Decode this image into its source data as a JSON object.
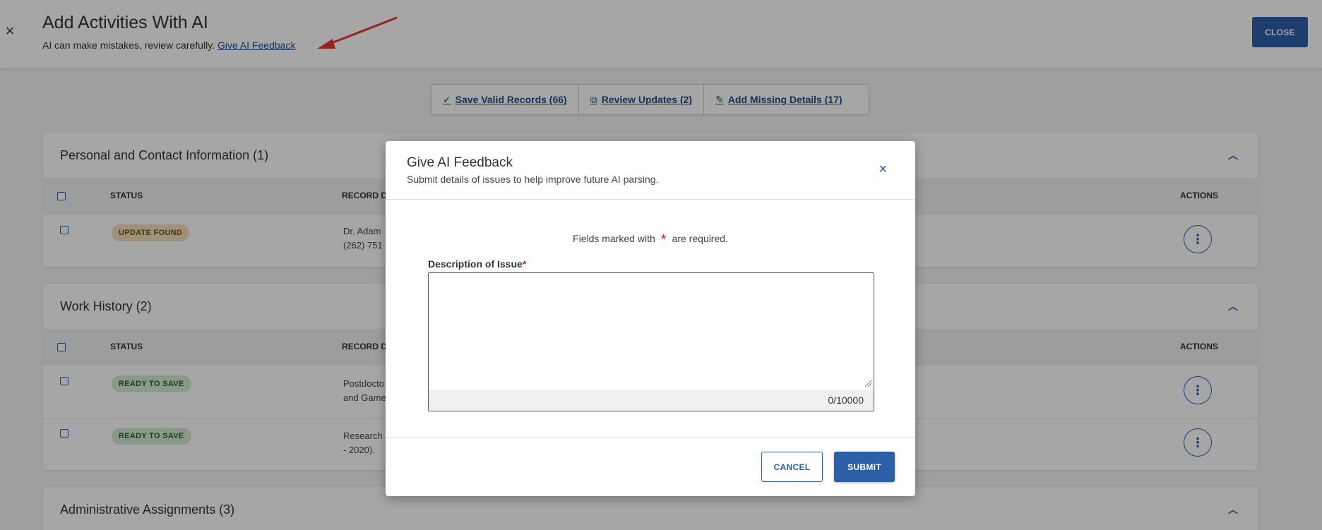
{
  "header": {
    "title": "Add Activities With AI",
    "subtitle": "AI can make mistakes, review carefully.",
    "feedback_link": "Give AI Feedback",
    "close_label": "CLOSE",
    "close_x": "×"
  },
  "toolbar": {
    "save_label": "Save Valid Records (66)",
    "review_label": "Review Updates (2)",
    "add_label": "Add Missing Details (17)"
  },
  "sections": {
    "personal": {
      "title": "Personal and Contact Information (1)",
      "col_status": "STATUS",
      "col_record": "RECORD D",
      "col_actions": "ACTIONS",
      "rows": [
        {
          "status": "UPDATE FOUND",
          "text1": "Dr. Adam",
          "text2": "(262) 751"
        }
      ]
    },
    "work": {
      "title": "Work History (2)",
      "col_status": "STATUS",
      "col_record": "RECORD D",
      "col_actions": "ACTIONS",
      "rows": [
        {
          "status": "READY TO SAVE",
          "text1": "Postdocto",
          "text2": "and Game"
        },
        {
          "status": "READY TO SAVE",
          "text1": "Research",
          "text2": "- 2020)."
        }
      ]
    },
    "admin": {
      "title": "Administrative Assignments (3)"
    }
  },
  "modal": {
    "title": "Give AI Feedback",
    "subtitle": "Submit details of issues to help improve future AI parsing.",
    "close_x": "×",
    "required_prefix": "Fields marked with",
    "required_star": "*",
    "required_suffix": "are required.",
    "field_label": "Description of Issue",
    "field_required": "*",
    "field_value": "",
    "counter": "0/10000",
    "cancel_label": "CANCEL",
    "submit_label": "SUBMIT"
  },
  "colors": {
    "primary": "#2d5ea8",
    "link": "#1f4d8c",
    "required": "#c62828",
    "arrow": "#e53935"
  },
  "icons": [
    "close-icon",
    "check-icon",
    "copy-icon",
    "pencil-icon",
    "chevron-up-icon",
    "kebab-menu-icon",
    "resize-grip-icon",
    "arrow-annotation"
  ]
}
